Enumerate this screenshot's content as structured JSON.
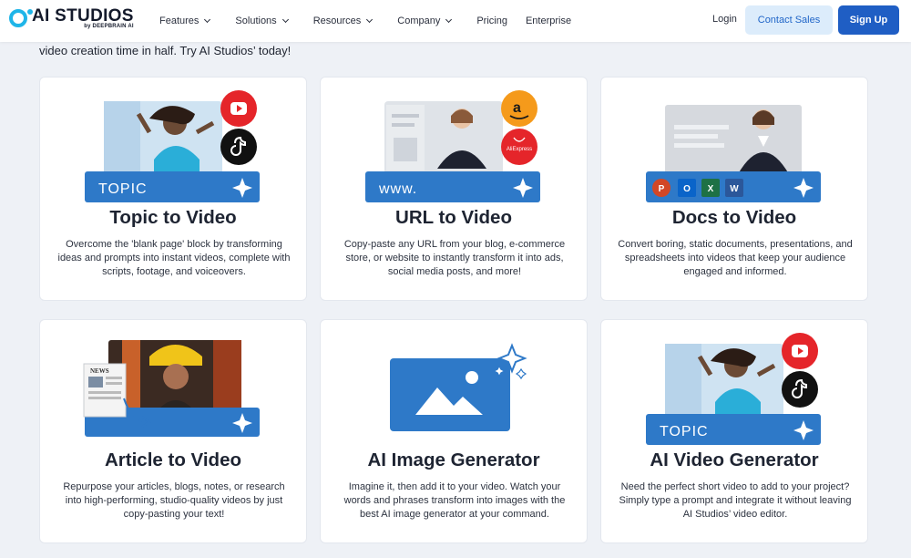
{
  "header": {
    "logo_name": "AI STUDIOS",
    "logo_sub": "by DEEPBRAIN AI",
    "nav": [
      {
        "label": "Features",
        "dropdown": true
      },
      {
        "label": "Solutions",
        "dropdown": true
      },
      {
        "label": "Resources",
        "dropdown": true
      },
      {
        "label": "Company",
        "dropdown": true
      },
      {
        "label": "Pricing",
        "dropdown": false
      },
      {
        "label": "Enterprise",
        "dropdown": false
      }
    ],
    "login": "Login",
    "contact_sales": "Contact Sales",
    "sign_up": "Sign Up"
  },
  "intro_text": "video creation time in half. Try AI Studios’ today!",
  "cards": [
    {
      "title": "Topic to Video",
      "desc": "Overcome the 'blank page' block by transforming ideas and prompts into instant videos, complete with scripts, footage, and voiceovers.",
      "bar_label": "TOPIC"
    },
    {
      "title": "URL to Video",
      "desc": "Copy-paste any URL from your blog, e-commerce store, or website to instantly transform it into ads, social media posts, and more!",
      "bar_label": "www."
    },
    {
      "title": "Docs to Video",
      "desc": "Convert boring, static documents, presentations, and spreadsheets into videos that keep your audience engaged and informed."
    },
    {
      "title": "Article to Video",
      "desc": "Repurpose your articles, blogs, notes, or research into high-performing, studio-quality videos by just copy-pasting your text!",
      "news_label": "NEWS"
    },
    {
      "title": "AI Image Generator",
      "desc": "Imagine it, then add it to your video. Watch your words and phrases transform into images with the best AI image generator at your command."
    },
    {
      "title": "AI Video Generator",
      "desc": "Need the perfect short video to add to your project? Simply type a prompt and integrate it without leaving AI Studios’ video editor.",
      "bar_label": "TOPIC"
    }
  ],
  "badges": {
    "aliexpress": "AliExpress",
    "ppt": "P",
    "outlook": "O",
    "excel": "X",
    "word": "W"
  },
  "colors": {
    "accent": "#1f5ec4",
    "youtube": "#e5252a",
    "tiktok": "#111111",
    "amazon": "#f59a1b",
    "bar": "#2e79c8"
  }
}
